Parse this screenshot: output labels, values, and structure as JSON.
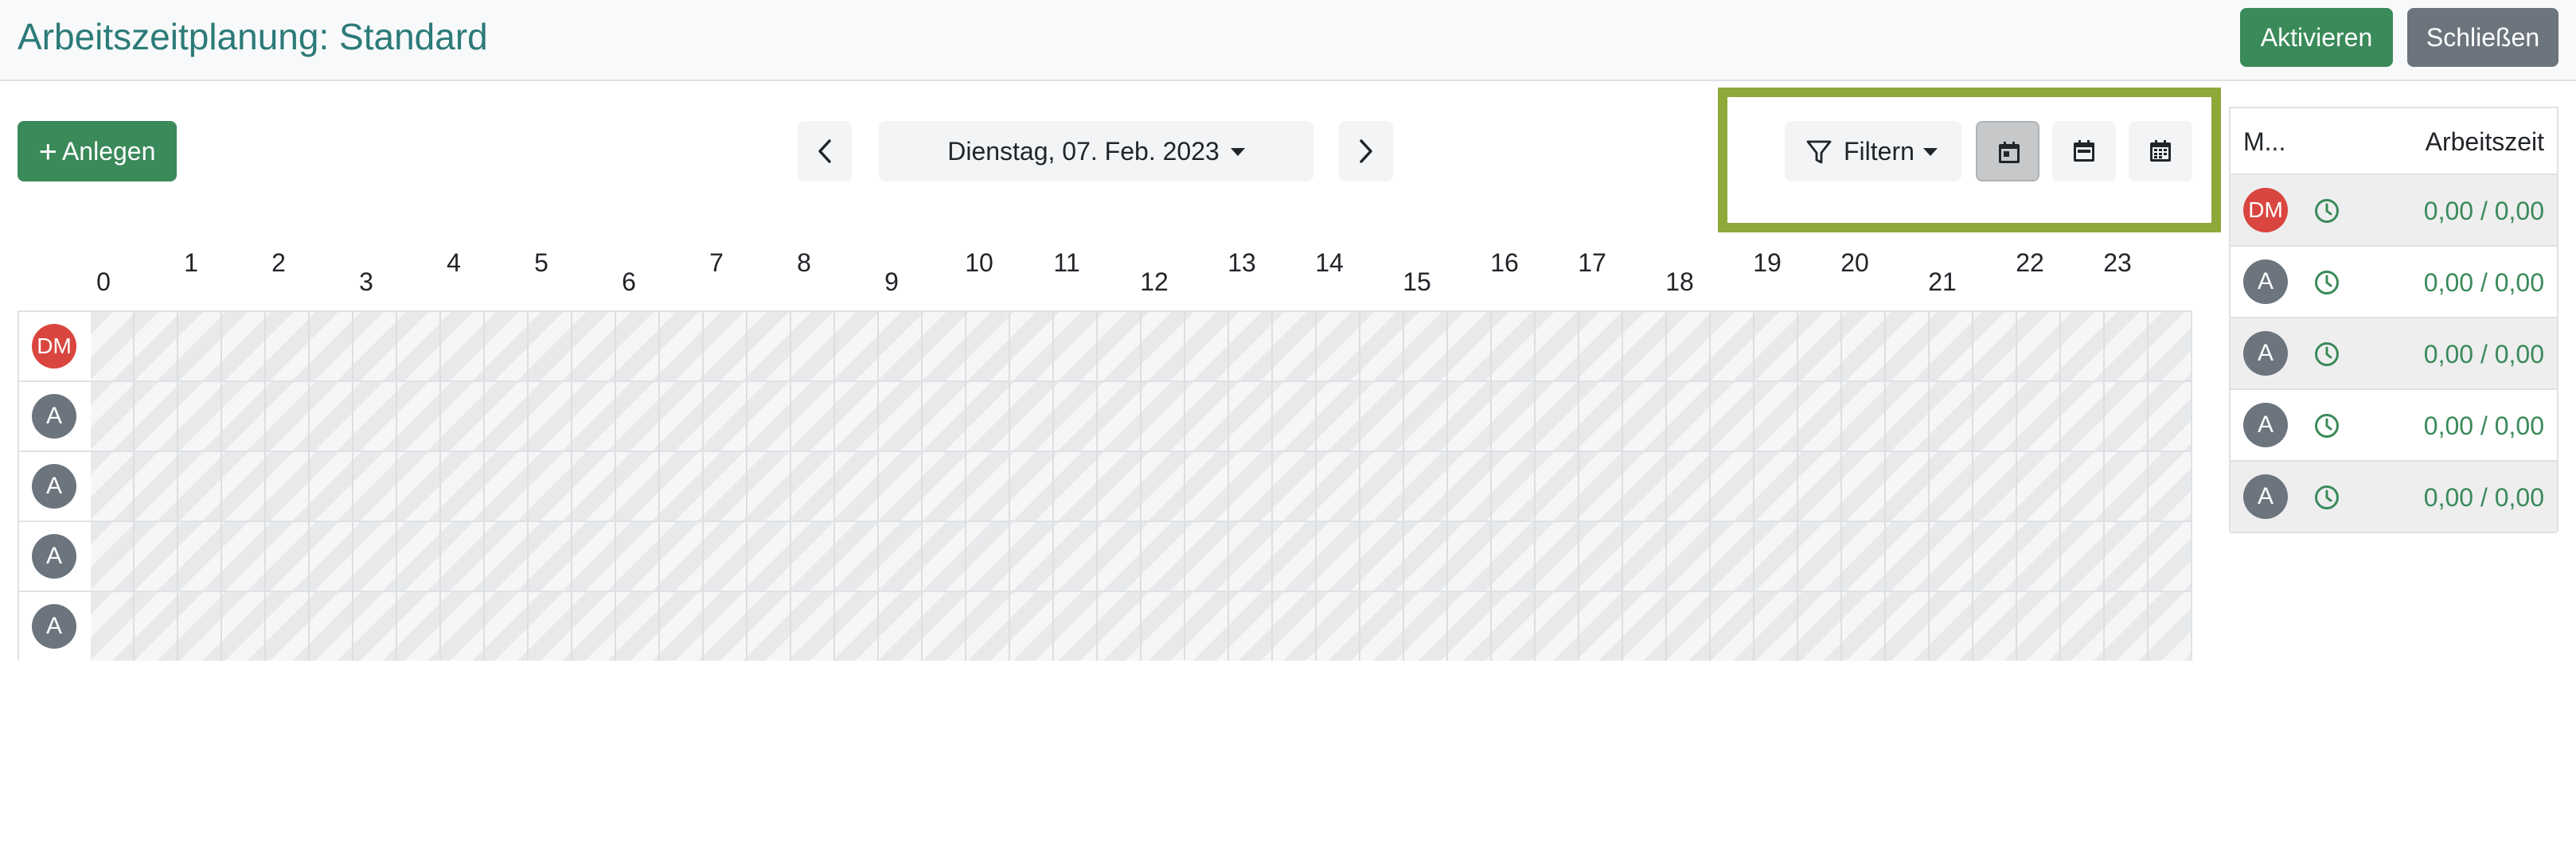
{
  "header": {
    "title": "Arbeitszeitplanung: Standard",
    "activate_label": "Aktivieren",
    "close_label": "Schließen"
  },
  "toolbar": {
    "create_label": "Anlegen",
    "create_icon": "plus-icon",
    "date_label": "Dienstag, 07. Feb. 2023",
    "filter_label": "Filtern",
    "view_buttons": [
      "day-view-icon",
      "week-view-icon",
      "month-view-icon"
    ],
    "active_view": "day-view-icon"
  },
  "timeline": {
    "hours": [
      "0",
      "1",
      "2",
      "3",
      "4",
      "5",
      "6",
      "7",
      "8",
      "9",
      "10",
      "11",
      "12",
      "13",
      "14",
      "15",
      "16",
      "17",
      "18",
      "19",
      "20",
      "21",
      "22",
      "23"
    ],
    "rows": [
      {
        "initials": "DM",
        "color": "#d9463f"
      },
      {
        "initials": "A",
        "color": "#6c757d"
      },
      {
        "initials": "A",
        "color": "#6c757d"
      },
      {
        "initials": "A",
        "color": "#6c757d"
      },
      {
        "initials": "A",
        "color": "#6c757d"
      }
    ]
  },
  "summary": {
    "col_member": "M...",
    "col_worktime": "Arbeitszeit",
    "rows": [
      {
        "initials": "DM",
        "worktime": "0,00 / 0,00"
      },
      {
        "initials": "A",
        "worktime": "0,00 / 0,00"
      },
      {
        "initials": "A",
        "worktime": "0,00 / 0,00"
      },
      {
        "initials": "A",
        "worktime": "0,00 / 0,00"
      },
      {
        "initials": "A",
        "worktime": "0,00 / 0,00"
      }
    ]
  },
  "colors": {
    "accent_green": "#3a8a5a",
    "title_teal": "#2b7a78",
    "highlight": "#8fa83a"
  }
}
